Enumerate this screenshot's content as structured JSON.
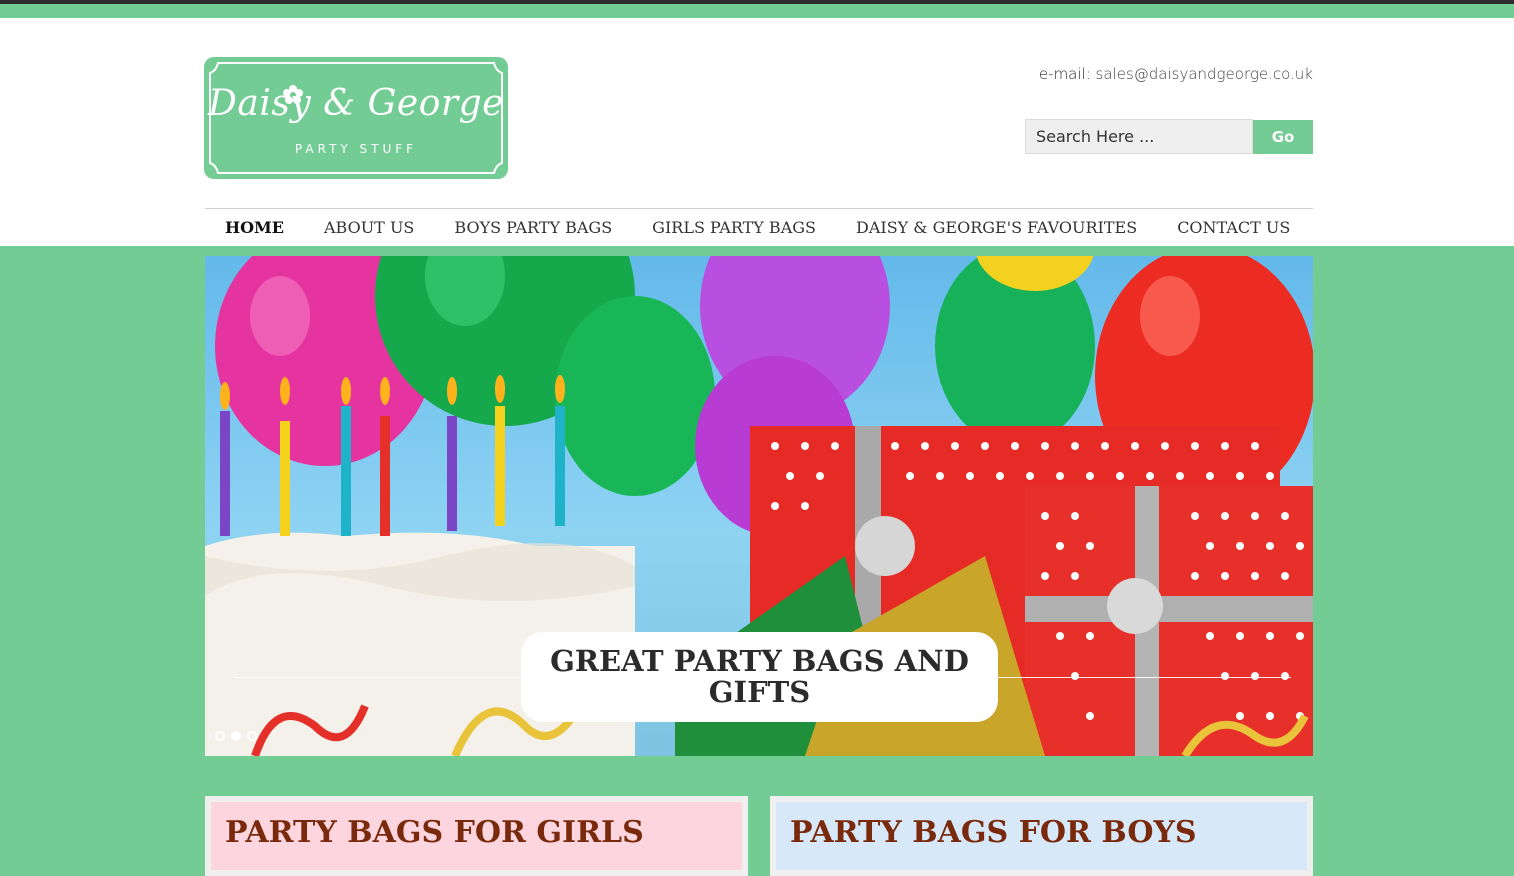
{
  "colors": {
    "brand_green": "#74cc95",
    "girls_pink": "#fdd5de",
    "boys_blue": "#d7e9f8",
    "heading_brown": "#7a2a0c"
  },
  "logo": {
    "name": "Daisy & George",
    "tagline": "PARTY STUFF",
    "icon": "flower-icon"
  },
  "header": {
    "email_label": "e-mail:",
    "email": "sales@daisyandgeorge.co.uk",
    "search_placeholder": "Search Here ...",
    "search_button": "Go"
  },
  "nav": {
    "items": [
      {
        "label": "HOME",
        "active": true
      },
      {
        "label": "ABOUT US"
      },
      {
        "label": "BOYS PARTY BAGS"
      },
      {
        "label": "GIRLS PARTY BAGS"
      },
      {
        "label": "DAISY & GEORGE'S FAVOURITES"
      },
      {
        "label": "CONTACT US"
      }
    ]
  },
  "slider": {
    "caption": "GREAT PARTY BAGS AND GIFTS",
    "slide_count": 3,
    "active_slide": 2
  },
  "cards": [
    {
      "title": "PARTY BAGS FOR GIRLS"
    },
    {
      "title": "PARTY BAGS FOR BOYS"
    }
  ]
}
